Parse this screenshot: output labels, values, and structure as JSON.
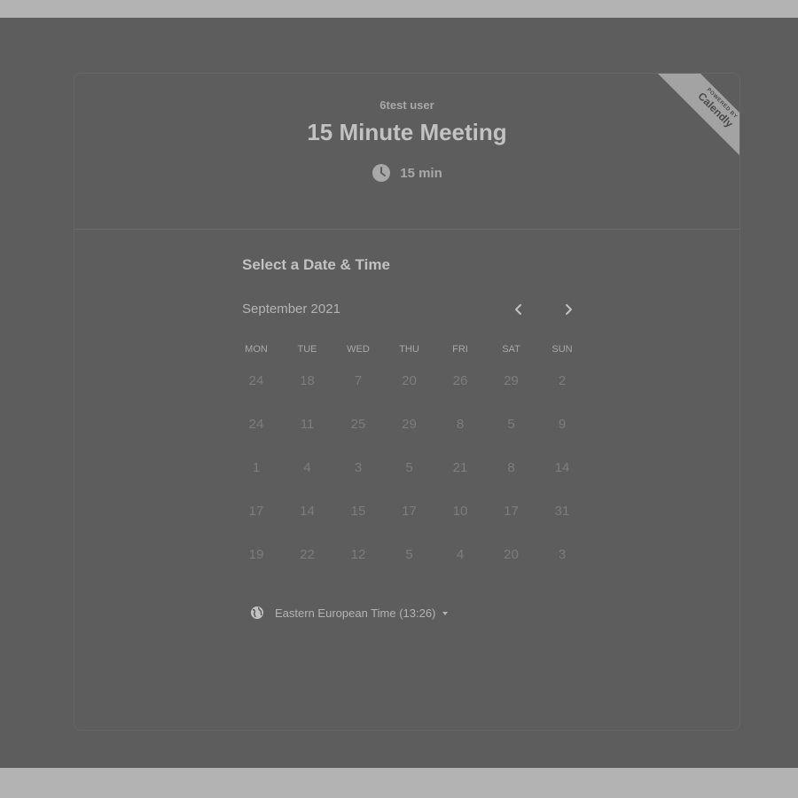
{
  "host": {
    "name": "6test user"
  },
  "event": {
    "title": "15 Minute Meeting",
    "duration": "15 min"
  },
  "badge": {
    "powered_by": "POWERED BY",
    "brand": "Calendly"
  },
  "calendar": {
    "section_title": "Select a Date & Time",
    "month": "September 2021",
    "weekdays": [
      "MON",
      "TUE",
      "WED",
      "THU",
      "FRI",
      "SAT",
      "SUN"
    ],
    "weeks": [
      [
        "24",
        "18",
        "7",
        "20",
        "26",
        "29",
        "2"
      ],
      [
        "24",
        "11",
        "25",
        "29",
        "8",
        "5",
        "9"
      ],
      [
        "1",
        "4",
        "3",
        "5",
        "21",
        "8",
        "14"
      ],
      [
        "17",
        "14",
        "15",
        "17",
        "10",
        "17",
        "31"
      ],
      [
        "19",
        "22",
        "12",
        "5",
        "4",
        "20",
        "3"
      ]
    ]
  },
  "timezone": {
    "label": "Eastern European Time (13:26)"
  },
  "icons": {
    "clock": "clock-icon",
    "globe": "globe-icon",
    "prev": "chevron-left-icon",
    "next": "chevron-right-icon",
    "dropdown": "caret-down-icon"
  }
}
